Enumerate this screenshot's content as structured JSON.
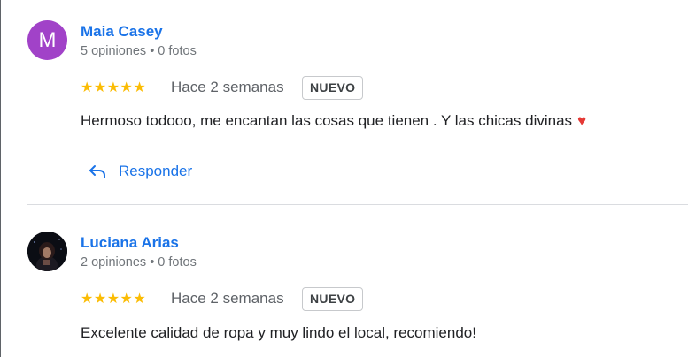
{
  "reviews": [
    {
      "avatar_letter": "M",
      "avatar_color": "#a142c8",
      "name": "Maia Casey",
      "meta": "5 opiniones • 0 fotos",
      "rating": 5,
      "stars": "★★★★★",
      "when": "Hace 2 semanas",
      "badge": "NUEVO",
      "text": "Hermoso todooo, me encantan las cosas que tienen . Y las chicas divinas",
      "emoji": "♥",
      "reply_label": "Responder"
    },
    {
      "avatar_letter": "",
      "name": "Luciana Arias",
      "meta": "2 opiniones • 0 fotos",
      "rating": 5,
      "stars": "★★★★★",
      "when": "Hace 2 semanas",
      "badge": "NUEVO",
      "text": "Excelente calidad de ropa y muy lindo el local, recomiendo!"
    }
  ],
  "colors": {
    "link": "#1a73e8",
    "star": "#fbbc04",
    "heart": "#e53935"
  }
}
